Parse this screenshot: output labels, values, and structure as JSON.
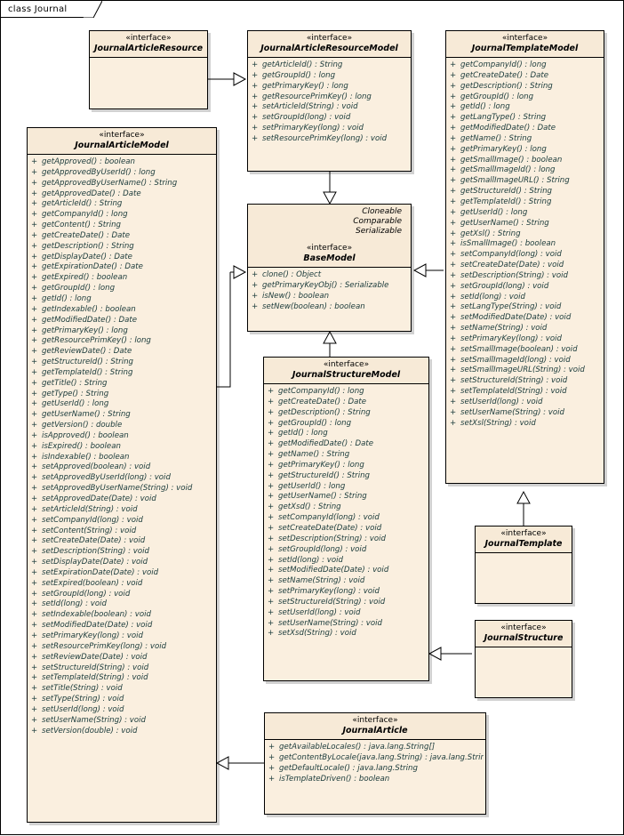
{
  "frame": {
    "label": "class Journal"
  },
  "boxes": {
    "journal_article_resource": {
      "stereotype": "«interface»",
      "name": "JournalArticleResource",
      "members": []
    },
    "journal_article_resource_model": {
      "stereotype": "«interface»",
      "name": "JournalArticleResourceModel",
      "members": [
        {
          "vis": "+",
          "sig": "getArticleId() : String"
        },
        {
          "vis": "+",
          "sig": "getGroupId() : long"
        },
        {
          "vis": "+",
          "sig": "getPrimaryKey() : long"
        },
        {
          "vis": "+",
          "sig": "getResourcePrimKey() : long"
        },
        {
          "vis": "+",
          "sig": "setArticleId(String) : void"
        },
        {
          "vis": "+",
          "sig": "setGroupId(long) : void"
        },
        {
          "vis": "+",
          "sig": "setPrimaryKey(long) : void"
        },
        {
          "vis": "+",
          "sig": "setResourcePrimKey(long) : void"
        }
      ]
    },
    "journal_template_model": {
      "stereotype": "«interface»",
      "name": "JournalTemplateModel",
      "members": [
        {
          "vis": "+",
          "sig": "getCompanyId() : long"
        },
        {
          "vis": "+",
          "sig": "getCreateDate() : Date"
        },
        {
          "vis": "+",
          "sig": "getDescription() : String"
        },
        {
          "vis": "+",
          "sig": "getGroupId() : long"
        },
        {
          "vis": "+",
          "sig": "getId() : long"
        },
        {
          "vis": "+",
          "sig": "getLangType() : String"
        },
        {
          "vis": "+",
          "sig": "getModifiedDate() : Date"
        },
        {
          "vis": "+",
          "sig": "getName() : String"
        },
        {
          "vis": "+",
          "sig": "getPrimaryKey() : long"
        },
        {
          "vis": "+",
          "sig": "getSmallImage() : boolean"
        },
        {
          "vis": "+",
          "sig": "getSmallImageId() : long"
        },
        {
          "vis": "+",
          "sig": "getSmallImageURL() : String"
        },
        {
          "vis": "+",
          "sig": "getStructureId() : String"
        },
        {
          "vis": "+",
          "sig": "getTemplateId() : String"
        },
        {
          "vis": "+",
          "sig": "getUserId() : long"
        },
        {
          "vis": "+",
          "sig": "getUserName() : String"
        },
        {
          "vis": "+",
          "sig": "getXsl() : String"
        },
        {
          "vis": "+",
          "sig": "isSmallImage() : boolean"
        },
        {
          "vis": "+",
          "sig": "setCompanyId(long) : void"
        },
        {
          "vis": "+",
          "sig": "setCreateDate(Date) : void"
        },
        {
          "vis": "+",
          "sig": "setDescription(String) : void"
        },
        {
          "vis": "+",
          "sig": "setGroupId(long) : void"
        },
        {
          "vis": "+",
          "sig": "setId(long) : void"
        },
        {
          "vis": "+",
          "sig": "setLangType(String) : void"
        },
        {
          "vis": "+",
          "sig": "setModifiedDate(Date) : void"
        },
        {
          "vis": "+",
          "sig": "setName(String) : void"
        },
        {
          "vis": "+",
          "sig": "setPrimaryKey(long) : void"
        },
        {
          "vis": "+",
          "sig": "setSmallImage(boolean) : void"
        },
        {
          "vis": "+",
          "sig": "setSmallImageId(long) : void"
        },
        {
          "vis": "+",
          "sig": "setSmallImageURL(String) : void"
        },
        {
          "vis": "+",
          "sig": "setStructureId(String) : void"
        },
        {
          "vis": "+",
          "sig": "setTemplateId(String) : void"
        },
        {
          "vis": "+",
          "sig": "setUserId(long) : void"
        },
        {
          "vis": "+",
          "sig": "setUserName(String) : void"
        },
        {
          "vis": "+",
          "sig": "setXsl(String) : void"
        }
      ]
    },
    "journal_article_model": {
      "stereotype": "«interface»",
      "name": "JournalArticleModel",
      "members": [
        {
          "vis": "+",
          "sig": "getApproved() : boolean"
        },
        {
          "vis": "+",
          "sig": "getApprovedByUserId() : long"
        },
        {
          "vis": "+",
          "sig": "getApprovedByUserName() : String"
        },
        {
          "vis": "+",
          "sig": "getApprovedDate() : Date"
        },
        {
          "vis": "+",
          "sig": "getArticleId() : String"
        },
        {
          "vis": "+",
          "sig": "getCompanyId() : long"
        },
        {
          "vis": "+",
          "sig": "getContent() : String"
        },
        {
          "vis": "+",
          "sig": "getCreateDate() : Date"
        },
        {
          "vis": "+",
          "sig": "getDescription() : String"
        },
        {
          "vis": "+",
          "sig": "getDisplayDate() : Date"
        },
        {
          "vis": "+",
          "sig": "getExpirationDate() : Date"
        },
        {
          "vis": "+",
          "sig": "getExpired() : boolean"
        },
        {
          "vis": "+",
          "sig": "getGroupId() : long"
        },
        {
          "vis": "+",
          "sig": "getId() : long"
        },
        {
          "vis": "+",
          "sig": "getIndexable() : boolean"
        },
        {
          "vis": "+",
          "sig": "getModifiedDate() : Date"
        },
        {
          "vis": "+",
          "sig": "getPrimaryKey() : long"
        },
        {
          "vis": "+",
          "sig": "getResourcePrimKey() : long"
        },
        {
          "vis": "+",
          "sig": "getReviewDate() : Date"
        },
        {
          "vis": "+",
          "sig": "getStructureId() : String"
        },
        {
          "vis": "+",
          "sig": "getTemplateId() : String"
        },
        {
          "vis": "+",
          "sig": "getTitle() : String"
        },
        {
          "vis": "+",
          "sig": "getType() : String"
        },
        {
          "vis": "+",
          "sig": "getUserId() : long"
        },
        {
          "vis": "+",
          "sig": "getUserName() : String"
        },
        {
          "vis": "+",
          "sig": "getVersion() : double"
        },
        {
          "vis": "+",
          "sig": "isApproved() : boolean"
        },
        {
          "vis": "+",
          "sig": "isExpired() : boolean"
        },
        {
          "vis": "+",
          "sig": "isIndexable() : boolean"
        },
        {
          "vis": "+",
          "sig": "setApproved(boolean) : void"
        },
        {
          "vis": "+",
          "sig": "setApprovedByUserId(long) : void"
        },
        {
          "vis": "+",
          "sig": "setApprovedByUserName(String) : void"
        },
        {
          "vis": "+",
          "sig": "setApprovedDate(Date) : void"
        },
        {
          "vis": "+",
          "sig": "setArticleId(String) : void"
        },
        {
          "vis": "+",
          "sig": "setCompanyId(long) : void"
        },
        {
          "vis": "+",
          "sig": "setContent(String) : void"
        },
        {
          "vis": "+",
          "sig": "setCreateDate(Date) : void"
        },
        {
          "vis": "+",
          "sig": "setDescription(String) : void"
        },
        {
          "vis": "+",
          "sig": "setDisplayDate(Date) : void"
        },
        {
          "vis": "+",
          "sig": "setExpirationDate(Date) : void"
        },
        {
          "vis": "+",
          "sig": "setExpired(boolean) : void"
        },
        {
          "vis": "+",
          "sig": "setGroupId(long) : void"
        },
        {
          "vis": "+",
          "sig": "setId(long) : void"
        },
        {
          "vis": "+",
          "sig": "setIndexable(boolean) : void"
        },
        {
          "vis": "+",
          "sig": "setModifiedDate(Date) : void"
        },
        {
          "vis": "+",
          "sig": "setPrimaryKey(long) : void"
        },
        {
          "vis": "+",
          "sig": "setResourcePrimKey(long) : void"
        },
        {
          "vis": "+",
          "sig": "setReviewDate(Date) : void"
        },
        {
          "vis": "+",
          "sig": "setStructureId(String) : void"
        },
        {
          "vis": "+",
          "sig": "setTemplateId(String) : void"
        },
        {
          "vis": "+",
          "sig": "setTitle(String) : void"
        },
        {
          "vis": "+",
          "sig": "setType(String) : void"
        },
        {
          "vis": "+",
          "sig": "setUserId(long) : void"
        },
        {
          "vis": "+",
          "sig": "setUserName(String) : void"
        },
        {
          "vis": "+",
          "sig": "setVersion(double) : void"
        }
      ]
    },
    "base_model": {
      "stereotype": "«interface»",
      "name": "BaseModel",
      "tags": [
        "Cloneable",
        "Comparable",
        "Serializable"
      ],
      "members": [
        {
          "vis": "+",
          "sig": "clone() : Object"
        },
        {
          "vis": "+",
          "sig": "getPrimaryKeyObj() : Serializable"
        },
        {
          "vis": "+",
          "sig": "isNew() : boolean"
        },
        {
          "vis": "+",
          "sig": "setNew(boolean) : boolean"
        }
      ]
    },
    "journal_structure_model": {
      "stereotype": "«interface»",
      "name": "JournalStructureModel",
      "members": [
        {
          "vis": "+",
          "sig": "getCompanyId() : long"
        },
        {
          "vis": "+",
          "sig": "getCreateDate() : Date"
        },
        {
          "vis": "+",
          "sig": "getDescription() : String"
        },
        {
          "vis": "+",
          "sig": "getGroupId() : long"
        },
        {
          "vis": "+",
          "sig": "getId() : long"
        },
        {
          "vis": "+",
          "sig": "getModifiedDate() : Date"
        },
        {
          "vis": "+",
          "sig": "getName() : String"
        },
        {
          "vis": "+",
          "sig": "getPrimaryKey() : long"
        },
        {
          "vis": "+",
          "sig": "getStructureId() : String"
        },
        {
          "vis": "+",
          "sig": "getUserId() : long"
        },
        {
          "vis": "+",
          "sig": "getUserName() : String"
        },
        {
          "vis": "+",
          "sig": "getXsd() : String"
        },
        {
          "vis": "+",
          "sig": "setCompanyId(long) : void"
        },
        {
          "vis": "+",
          "sig": "setCreateDate(Date) : void"
        },
        {
          "vis": "+",
          "sig": "setDescription(String) : void"
        },
        {
          "vis": "+",
          "sig": "setGroupId(long) : void"
        },
        {
          "vis": "+",
          "sig": "setId(long) : void"
        },
        {
          "vis": "+",
          "sig": "setModifiedDate(Date) : void"
        },
        {
          "vis": "+",
          "sig": "setName(String) : void"
        },
        {
          "vis": "+",
          "sig": "setPrimaryKey(long) : void"
        },
        {
          "vis": "+",
          "sig": "setStructureId(String) : void"
        },
        {
          "vis": "+",
          "sig": "setUserId(long) : void"
        },
        {
          "vis": "+",
          "sig": "setUserName(String) : void"
        },
        {
          "vis": "+",
          "sig": "setXsd(String) : void"
        }
      ]
    },
    "journal_template": {
      "stereotype": "«interface»",
      "name": "JournalTemplate",
      "members": []
    },
    "journal_structure": {
      "stereotype": "«interface»",
      "name": "JournalStructure",
      "members": []
    },
    "journal_article": {
      "stereotype": "«interface»",
      "name": "JournalArticle",
      "members": [
        {
          "vis": "+",
          "sig": "getAvailableLocales() : java.lang.String[]"
        },
        {
          "vis": "+",
          "sig": "getContentByLocale(java.lang.String) : java.lang.String"
        },
        {
          "vis": "+",
          "sig": "getDefaultLocale() : java.lang.String"
        },
        {
          "vis": "+",
          "sig": "isTemplateDriven() : boolean"
        }
      ]
    }
  },
  "colors": {
    "box_fill": "#faefdf",
    "box_header_fill": "#f7ead7",
    "border": "#000000",
    "member_text": "#1a3a3a",
    "background": "#ffffff"
  }
}
